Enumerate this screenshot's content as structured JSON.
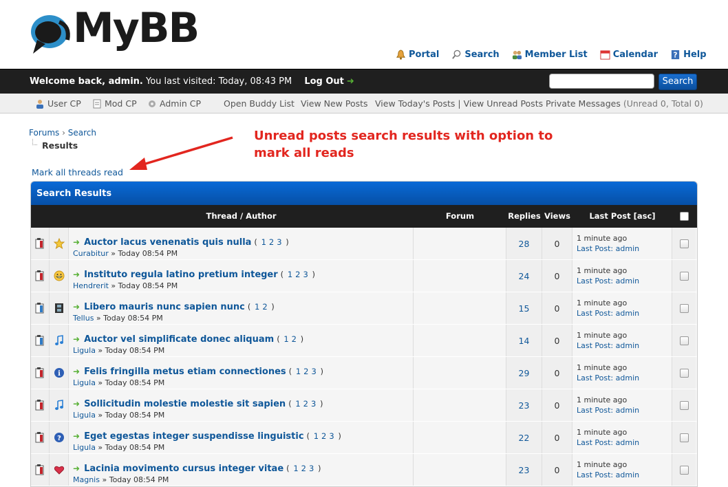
{
  "header": {
    "logo_text": "MyBB",
    "nav": [
      {
        "label": "Portal",
        "icon": "bell-icon"
      },
      {
        "label": "Search",
        "icon": "magnifier-icon"
      },
      {
        "label": "Member List",
        "icon": "members-icon"
      },
      {
        "label": "Calendar",
        "icon": "calendar-icon"
      },
      {
        "label": "Help",
        "icon": "help-icon"
      }
    ]
  },
  "panel": {
    "welcome_name": "Welcome back, admin.",
    "last_visit": "You last visited: Today, 08:43 PM",
    "logout": "Log Out",
    "search_placeholder": "",
    "search_button": "Search"
  },
  "subnav": {
    "user_cp": "User CP",
    "mod_cp": "Mod CP",
    "admin_cp": "Admin CP",
    "buddy": "Open Buddy List",
    "new_posts": "View New Posts",
    "todays_posts": "View Today's Posts",
    "separator": "|",
    "unread_posts": "View Unread Posts",
    "pm": "Private Messages",
    "pm_counts": "(Unread 0, Total 0)"
  },
  "breadcrumb": {
    "forums": "Forums",
    "sep": "›",
    "search": "Search",
    "current": "Results"
  },
  "annotation": {
    "line1": "Unread posts search results with option to",
    "line2": "mark all reads"
  },
  "mark_all": "Mark all threads read",
  "table": {
    "title": "Search Results",
    "columns": {
      "thread": "Thread / Author",
      "forum": "Forum",
      "replies": "Replies",
      "views": "Views",
      "lastpost": "Last Post [asc]"
    },
    "rows": [
      {
        "icon": "star-icon",
        "title": "Auctor lacus venenatis quis nulla",
        "pages": [
          "1",
          "2",
          "3"
        ],
        "author": "Curabitur",
        "date": "Today 08:54 PM",
        "replies": "28",
        "views": "0",
        "last_time": "1 minute ago",
        "last_by": "admin",
        "status": "hot"
      },
      {
        "icon": "grin-icon",
        "title": "Instituto regula latino pretium integer",
        "pages": [
          "1",
          "2",
          "3"
        ],
        "author": "Hendrerit",
        "date": "Today 08:54 PM",
        "replies": "24",
        "views": "0",
        "last_time": "1 minute ago",
        "last_by": "admin",
        "status": "hot"
      },
      {
        "icon": "film-icon",
        "title": "Libero mauris nunc sapien nunc",
        "pages": [
          "1",
          "2"
        ],
        "author": "Tellus",
        "date": "Today 08:54 PM",
        "replies": "15",
        "views": "0",
        "last_time": "1 minute ago",
        "last_by": "admin",
        "status": "normal"
      },
      {
        "icon": "music-note-icon",
        "title": "Auctor vel simplificate donec aliquam",
        "pages": [
          "1",
          "2"
        ],
        "author": "Ligula",
        "date": "Today 08:54 PM",
        "replies": "14",
        "views": "0",
        "last_time": "1 minute ago",
        "last_by": "admin",
        "status": "normal"
      },
      {
        "icon": "info-icon",
        "title": "Felis fringilla metus etiam connectiones",
        "pages": [
          "1",
          "2",
          "3"
        ],
        "author": "Ligula",
        "date": "Today 08:54 PM",
        "replies": "29",
        "views": "0",
        "last_time": "1 minute ago",
        "last_by": "admin",
        "status": "hot"
      },
      {
        "icon": "music-note-icon",
        "title": "Sollicitudin molestie molestie sit sapien",
        "pages": [
          "1",
          "2",
          "3"
        ],
        "author": "Ligula",
        "date": "Today 08:54 PM",
        "replies": "23",
        "views": "0",
        "last_time": "1 minute ago",
        "last_by": "admin",
        "status": "hot"
      },
      {
        "icon": "question-icon",
        "title": "Eget egestas integer suspendisse linguistic",
        "pages": [
          "1",
          "2",
          "3"
        ],
        "author": "Ligula",
        "date": "Today 08:54 PM",
        "replies": "22",
        "views": "0",
        "last_time": "1 minute ago",
        "last_by": "admin",
        "status": "hot"
      },
      {
        "icon": "heart-icon",
        "title": "Lacinia movimento cursus integer vitae",
        "pages": [
          "1",
          "2",
          "3"
        ],
        "author": "Magnis",
        "date": "Today 08:54 PM",
        "replies": "23",
        "views": "0",
        "last_time": "1 minute ago",
        "last_by": "admin",
        "status": "hot"
      }
    ],
    "last_post_label": "Last Post:"
  }
}
